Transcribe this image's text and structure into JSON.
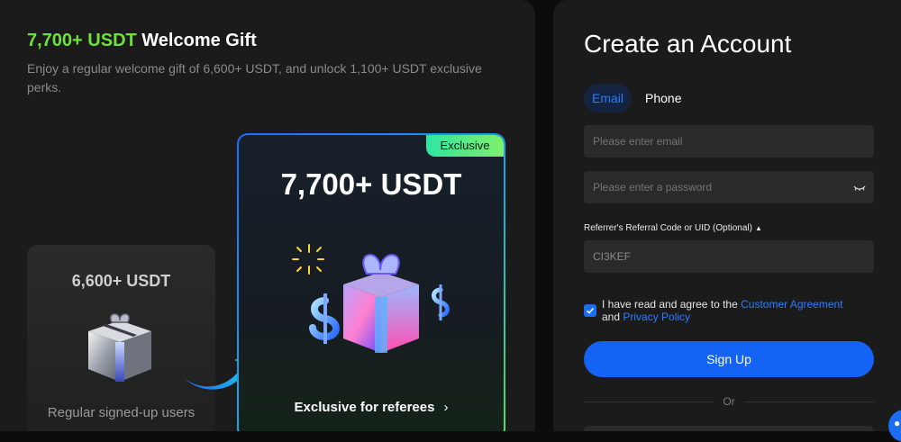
{
  "promo": {
    "headline_accent": "7,700+ USDT",
    "headline_rest": " Welcome Gift",
    "subline": "Enjoy a regular welcome gift of 6,600+ USDT, and unlock 1,100+ USDT exclusive perks.",
    "regular_card": {
      "amount": "6,600+ USDT",
      "caption": "Regular signed-up users",
      "icon": "gift-box-icon"
    },
    "exclusive_card": {
      "badge": "Exclusive",
      "amount": "7,700+ USDT",
      "link_label": "Exclusive for referees",
      "link_icon": "chevron-right-icon",
      "icon": "gift-box-icon"
    },
    "colors": {
      "accent_green": "#6fe13a",
      "brand_blue": "#1463f5"
    }
  },
  "signup_form": {
    "title": "Create an Account",
    "tabs": [
      {
        "label": "Email",
        "active": true
      },
      {
        "label": "Phone",
        "active": false
      }
    ],
    "email_placeholder": "Please enter email",
    "password_placeholder": "Please enter a password",
    "password_toggle_icon": "eye-closed-icon",
    "referral_label": "Referrer's Referral Code or UID (Optional)",
    "referral_value": "CI3KEF",
    "agree_prefix": "I have read and agree to the",
    "agree_link1": "Customer Agreement",
    "agree_and": "and",
    "agree_link2": "Privacy Policy",
    "agreed": true,
    "signup_label": "Sign Up",
    "or_label": "Or"
  }
}
